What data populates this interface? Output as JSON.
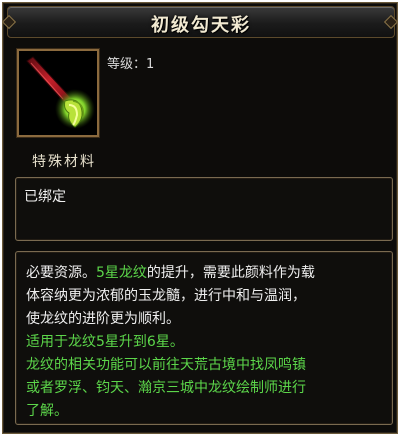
{
  "title": "初级勾天彩",
  "item": {
    "level_label": "等级：1",
    "category": "特殊材料",
    "icon": "brush-icon",
    "bind_status": "已绑定"
  },
  "description": {
    "l1_a": "必要资源。",
    "l1_hl": "5星龙纹",
    "l1_b": "的提升，需要此颜料作为载",
    "l2": "体容纳更为浓郁的玉龙髓，进行中和与温润，",
    "l3": "使龙纹的进阶更为顺利。",
    "l4": "适用于龙纹5星升到6星。",
    "l5": "龙纹的相关功能可以前往天荒古境中找凤鸣镇",
    "l6": "或者罗浮、钧天、瀚京三城中龙纹绘制师进行",
    "l7": "了解。"
  },
  "colors": {
    "highlight": "#5cd64a",
    "frame_border": "#8b6a3e",
    "text": "#efefef"
  }
}
